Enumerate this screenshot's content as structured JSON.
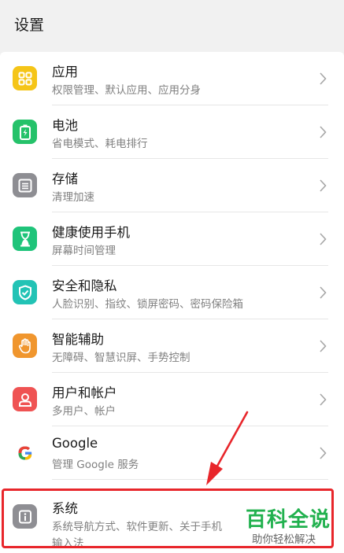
{
  "header": {
    "title": "设置"
  },
  "items": [
    {
      "title": "应用",
      "subtitle": "权限管理、默认应用、应用分身",
      "icon": "apps-icon",
      "color": "#f5c518"
    },
    {
      "title": "电池",
      "subtitle": "省电模式、耗电排行",
      "icon": "battery-icon",
      "color": "#25c26a"
    },
    {
      "title": "存储",
      "subtitle": "清理加速",
      "icon": "storage-icon",
      "color": "#8e8e93"
    },
    {
      "title": "健康使用手机",
      "subtitle": "屏幕时间管理",
      "icon": "hourglass-icon",
      "color": "#1fc47a"
    },
    {
      "title": "安全和隐私",
      "subtitle": "人脸识别、指纹、锁屏密码、密码保险箱",
      "icon": "shield-icon",
      "color": "#22c3b5"
    },
    {
      "title": "智能辅助",
      "subtitle": "无障碍、智慧识屏、手势控制",
      "icon": "hand-icon",
      "color": "#f0962e"
    },
    {
      "title": "用户和帐户",
      "subtitle": "多用户、帐户",
      "icon": "user-icon",
      "color": "#ef5353"
    },
    {
      "title": "Google",
      "subtitle": "管理 Google 服务",
      "icon": "google-icon",
      "color": "#4285f4"
    },
    {
      "title": "系统",
      "subtitle": "系统导航方式、软件更新、关于手机",
      "subtitle2": "输入法",
      "icon": "info-icon",
      "color": "#8e8e93"
    }
  ],
  "watermark": {
    "title": "百科全说",
    "subtitle": "助你轻松解决"
  },
  "colors": {
    "highlight": "#e8262b",
    "watermark": "#21b14e"
  }
}
